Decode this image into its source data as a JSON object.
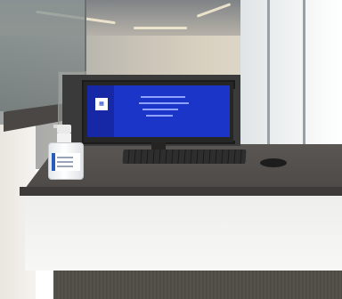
{
  "scene": {
    "description_tags": [
      "office",
      "desk-counter",
      "monitor",
      "keyboard",
      "mouse",
      "hand-sanitizer",
      "windows"
    ]
  },
  "colors": {
    "screen_blue": "#1a35c8",
    "counter_top": "#5a5653",
    "counter_front": "#f7f7f5",
    "floor": "#4c4c45",
    "bottle_label_accent": "#2a5db8"
  },
  "icons": {
    "screen_logo": "qr-code-icon"
  }
}
